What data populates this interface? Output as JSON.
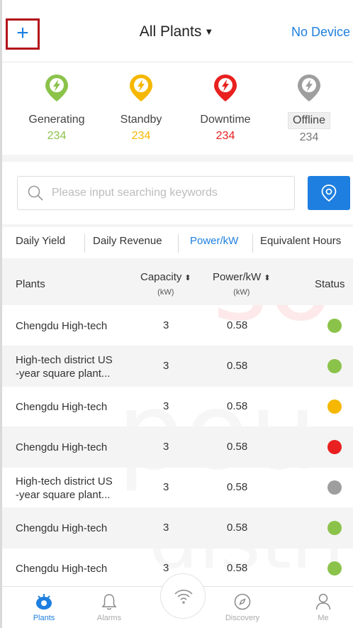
{
  "header": {
    "add_label": "+",
    "title": "All Plants",
    "title_caret": "▼",
    "no_device": "No Device"
  },
  "status": [
    {
      "label": "Generating",
      "count": "234",
      "color": "#8bc34a"
    },
    {
      "label": "Standby",
      "count": "234",
      "color": "#f5b700"
    },
    {
      "label": "Downtime",
      "count": "234",
      "color": "#e8201f"
    },
    {
      "label": "Offline",
      "count": "234",
      "color": "#9e9e9e"
    }
  ],
  "search": {
    "placeholder": "Please input searching keywords"
  },
  "tabs": [
    {
      "label": "Daily Yield",
      "active": false
    },
    {
      "label": "Daily Revenue",
      "active": false
    },
    {
      "label": "Power/kW",
      "active": true
    },
    {
      "label": "Equivalent Hours",
      "active": false
    }
  ],
  "table": {
    "headers": {
      "plants": "Plants",
      "capacity": "Capacity",
      "capacity_unit": "(kW)",
      "power": "Power/kW",
      "power_unit": "(kW)",
      "status": "Status",
      "sort_icon": "⬍"
    },
    "rows": [
      {
        "name_1": "Chengdu High-tech",
        "name_2": "",
        "capacity": "3",
        "power": "0.58",
        "status_color": "#8bc34a"
      },
      {
        "name_1": "High-tech district US",
        "name_2": "-year square plant...",
        "capacity": "3",
        "power": "0.58",
        "status_color": "#8bc34a"
      },
      {
        "name_1": "Chengdu High-tech",
        "name_2": "",
        "capacity": "3",
        "power": "0.58",
        "status_color": "#f5b700"
      },
      {
        "name_1": "Chengdu High-tech",
        "name_2": "",
        "capacity": "3",
        "power": "0.58",
        "status_color": "#e8201f"
      },
      {
        "name_1": "High-tech district US",
        "name_2": "-year square plant...",
        "capacity": "3",
        "power": "0.58",
        "status_color": "#9e9e9e"
      },
      {
        "name_1": "Chengdu High-tech",
        "name_2": "",
        "capacity": "3",
        "power": "0.58",
        "status_color": "#8bc34a"
      },
      {
        "name_1": "Chengdu High-tech",
        "name_2": "",
        "capacity": "3",
        "power": "0.58",
        "status_color": "#8bc34a"
      }
    ]
  },
  "nav": [
    {
      "label": "Plants",
      "icon": "plants-icon",
      "active": true
    },
    {
      "label": "Alarms",
      "icon": "bell-icon",
      "active": false
    },
    {
      "label": "Discovery",
      "icon": "compass-icon",
      "active": false
    },
    {
      "label": "Me",
      "icon": "person-icon",
      "active": false
    }
  ],
  "colors": {
    "accent": "#1e7fe0",
    "highlight_box": "#b3121a"
  }
}
